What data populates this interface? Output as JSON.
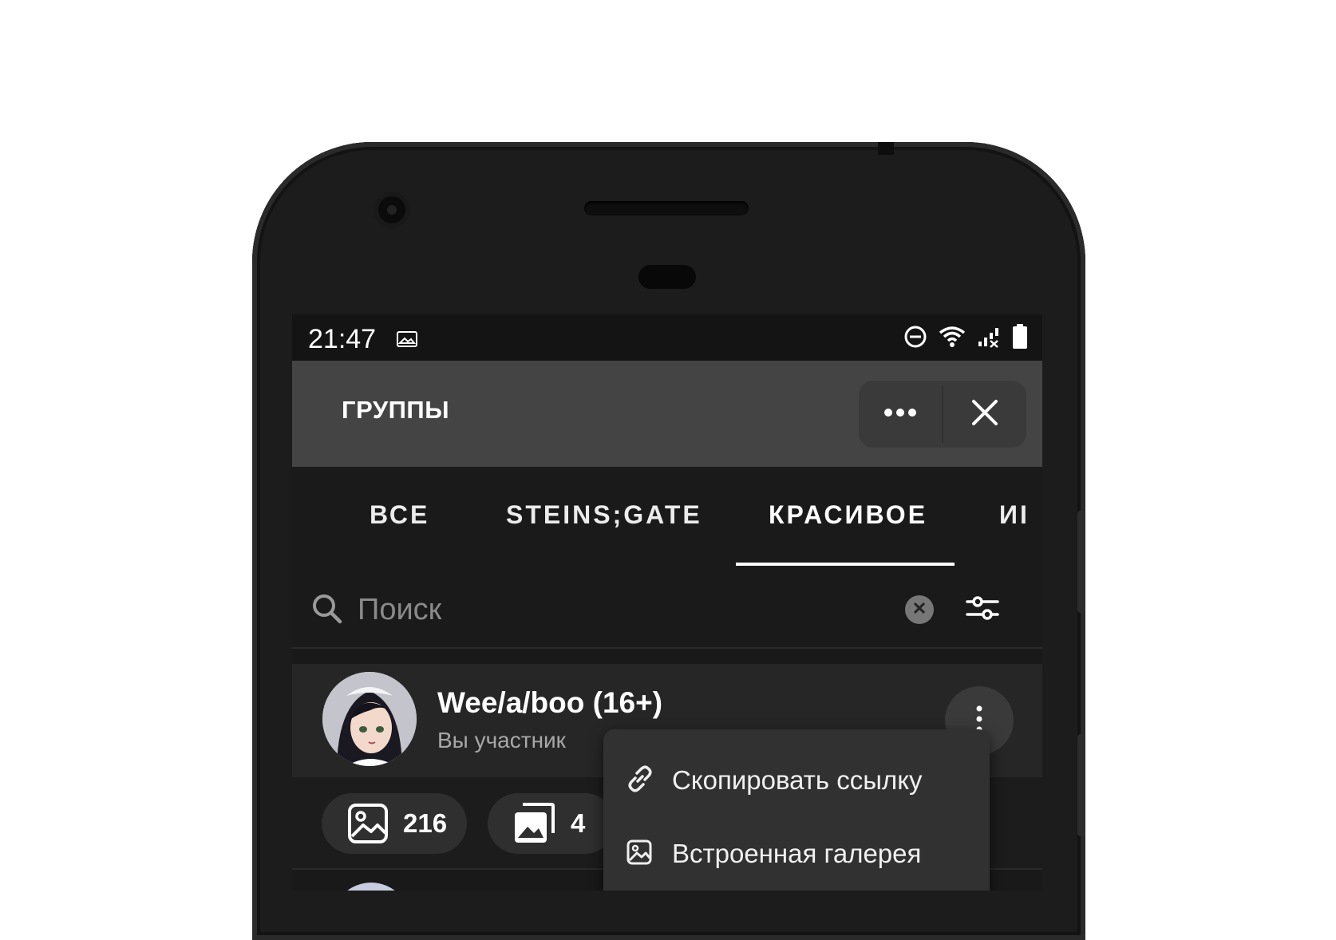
{
  "status_bar": {
    "time": "21:47",
    "icons": [
      "image-icon",
      "do-not-disturb-icon",
      "wifi-icon",
      "signal-icon",
      "battery-icon"
    ]
  },
  "app_bar": {
    "title": "ГРУППЫ",
    "more_icon": "more-horizontal-icon",
    "close_icon": "close-icon"
  },
  "tabs": [
    {
      "label": "ВСЕ",
      "selected": false
    },
    {
      "label": "STEINS;GATE",
      "selected": false
    },
    {
      "label": "КРАСИВОЕ",
      "selected": true
    },
    {
      "label": "ИІ",
      "selected": false
    }
  ],
  "search": {
    "placeholder": "Поиск",
    "value": ""
  },
  "group": {
    "name": "Wee/a/boo (16+)",
    "subtitle": "Вы участник",
    "stats": [
      {
        "icon": "image-icon",
        "value": "216"
      },
      {
        "icon": "albums-icon",
        "value": "4"
      }
    ]
  },
  "context_menu": {
    "items": [
      {
        "icon": "link-icon",
        "label": "Скопировать ссылку"
      },
      {
        "icon": "gallery-icon",
        "label": "Встроенная галерея"
      }
    ]
  },
  "colors": {
    "app_bar": "#444444",
    "background": "#191919",
    "row": "#262626",
    "menu": "#313131",
    "accent": "#ffffff"
  }
}
